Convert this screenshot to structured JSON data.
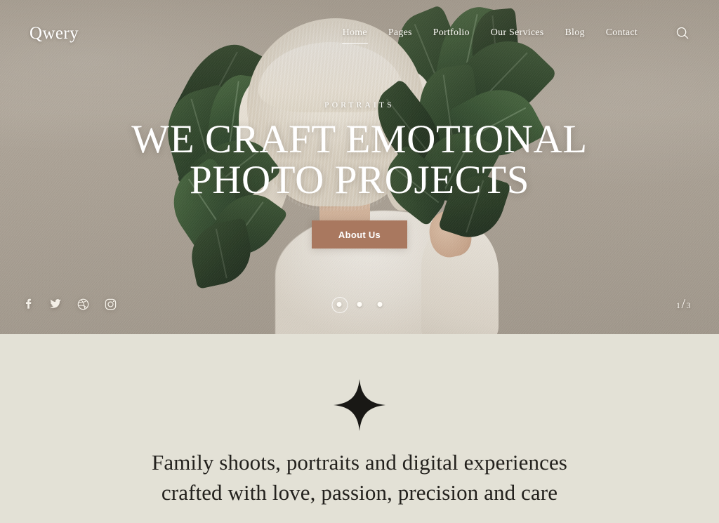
{
  "site": {
    "logo": "Qwery",
    "accent_color": "#a9785f",
    "hero_bg_color": "#b2a99c",
    "section_bg_color": "#e3e1d6",
    "text_light": "#ffffff",
    "text_dark": "#23211d"
  },
  "header": {
    "nav_items": [
      {
        "label": "Home",
        "active": true
      },
      {
        "label": "Pages",
        "active": false
      },
      {
        "label": "Portfolio",
        "active": false
      },
      {
        "label": "Our Services",
        "active": false
      },
      {
        "label": "Blog",
        "active": false
      },
      {
        "label": "Contact",
        "active": false
      }
    ],
    "search_icon": "search-icon"
  },
  "hero": {
    "eyebrow": "PORTRAITS",
    "headline_line1": "WE CRAFT EMOTIONAL",
    "headline_line2": "PHOTO PROJECTS",
    "cta_label": "About Us",
    "socials": [
      {
        "name": "facebook-icon",
        "glyph": "f"
      },
      {
        "name": "twitter-icon",
        "glyph": "twitter"
      },
      {
        "name": "dribbble-icon",
        "glyph": "dribbble"
      },
      {
        "name": "instagram-icon",
        "glyph": "instagram"
      }
    ],
    "slider": {
      "total_dots": 3,
      "active_index": 0,
      "current": "1",
      "separator": "/",
      "total": "3"
    }
  },
  "intro": {
    "ornament": "four-point-star-icon",
    "paragraph_line1": "Family shoots, portraits and digital",
    "paragraph_line2": "experiences crafted with love, passion,",
    "paragraph_line3": "precision and care"
  }
}
